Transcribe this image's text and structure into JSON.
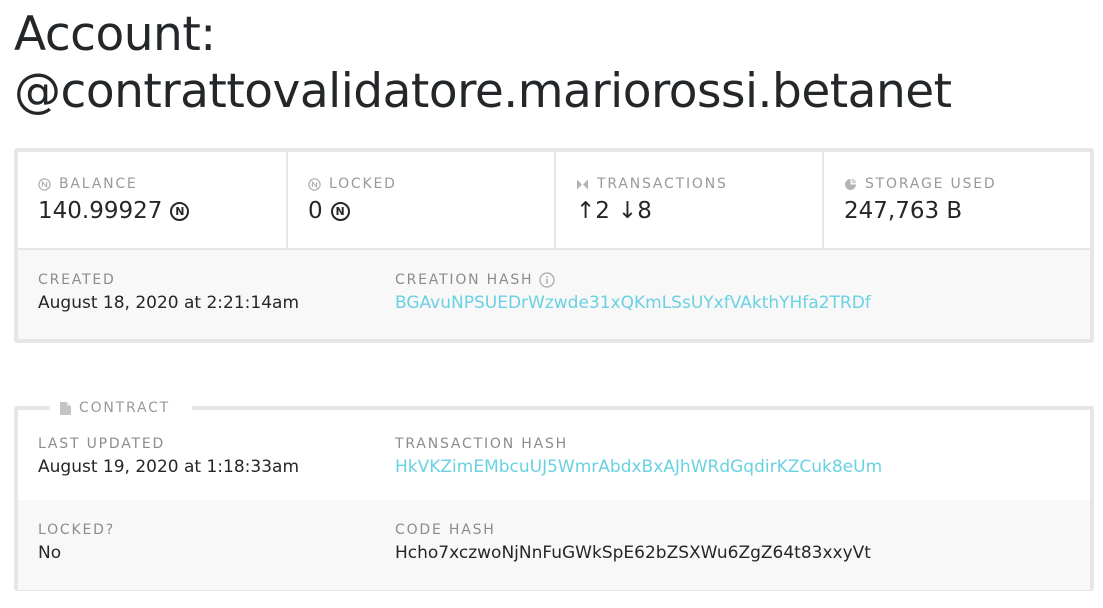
{
  "header": {
    "title_prefix": "Account:",
    "account_id": "@contrattovalidatore.mariorossi.betanet"
  },
  "stats": {
    "balance": {
      "label": "BALANCE",
      "value": "140.99927",
      "icon": "near-icon"
    },
    "locked": {
      "label": "LOCKED",
      "value": "0",
      "icon": "near-icon"
    },
    "transactions": {
      "label": "TRANSACTIONS",
      "out_count": "2",
      "in_count": "8",
      "icon": "transactions-icon"
    },
    "storage": {
      "label": "STORAGE USED",
      "value": "247,763 B",
      "icon": "storage-icon"
    }
  },
  "near_symbol": "N",
  "creation": {
    "created_label": "CREATED",
    "created_value": "August 18, 2020 at 2:21:14am",
    "hash_label": "CREATION HASH",
    "hash_value": "BGAvuNPSUEDrWzwde31xQKmLSsUYxfVAkthYHfa2TRDf"
  },
  "contract": {
    "legend": "CONTRACT",
    "last_updated_label": "LAST UPDATED",
    "last_updated_value": "August 19, 2020 at 1:18:33am",
    "tx_hash_label": "TRANSACTION HASH",
    "tx_hash_value": "HkVKZimEMbcuUJ5WmrAbdxBxAJhWRdGqdirKZCuk8eUm",
    "locked_label": "LOCKED?",
    "locked_value": "No",
    "code_hash_label": "CODE HASH",
    "code_hash_value": "Hcho7xczwoNjNnFuGWkSpE62bZSXWu6ZgZ64t83xxyVt"
  },
  "colors": {
    "link": "#6ad1e3",
    "label": "#999999",
    "text": "#24272a",
    "border": "#e6e6e6",
    "row_bg": "#f8f8f8"
  }
}
